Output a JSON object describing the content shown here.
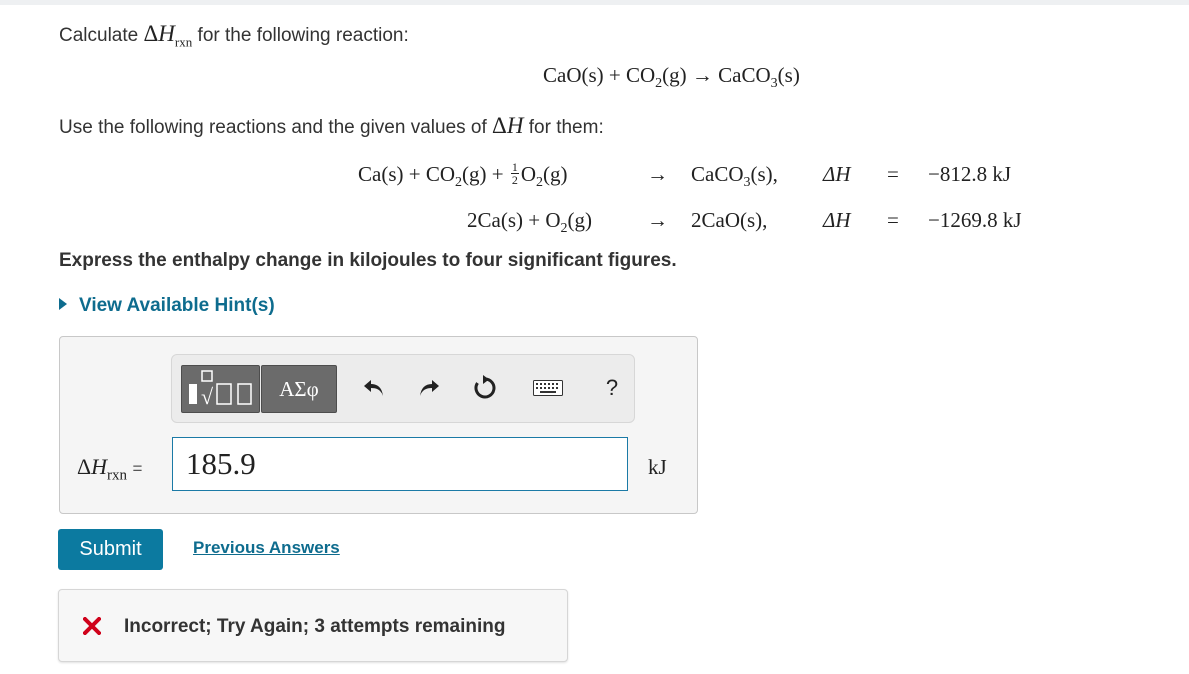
{
  "question": {
    "prefix": "Calculate",
    "delta": "Δ",
    "H": "H",
    "rxn": "rxn",
    "suffix": "for the following reaction:",
    "main_eq_lhs": "CaO(s) + CO",
    "main_eq_sub": "2",
    "main_eq_rhs": "(g) → CaCO",
    "main_eq_sub2": "3",
    "main_eq_end": "(s)",
    "use_text_a": "Use the following reactions and the given values of",
    "use_text_b": "for them:"
  },
  "reactions": [
    {
      "lhs": "Ca(s) + CO2(g) + ½O2(g)",
      "arrow": "→",
      "rhs": "CaCO3(s),",
      "dh_label": "ΔH",
      "eq": "=",
      "value": "−812.8 kJ"
    },
    {
      "lhs": "2Ca(s) + O2(g)",
      "arrow": "→",
      "rhs": "2CaO(s),",
      "dh_label": "ΔH",
      "eq": "=",
      "value": "−1269.8 kJ"
    }
  ],
  "instruction": "Express the enthalpy change in kilojoules to four significant figures.",
  "hint_link": "View Available Hint(s)",
  "toolbar": {
    "greek_label": "ΑΣφ",
    "help_label": "?"
  },
  "answer": {
    "label_delta": "Δ",
    "label_H": "H",
    "label_sub": "rxn",
    "label_eq": "=",
    "value": "185.9",
    "unit": "kJ"
  },
  "actions": {
    "submit_label": "Submit",
    "previous_label": "Previous Answers"
  },
  "feedback": {
    "icon": "x-icon",
    "text": "Incorrect; Try Again; 3 attempts remaining",
    "color": "#d0021b"
  },
  "colors": {
    "accent": "#0c7aa0",
    "link": "#0e6c8e"
  }
}
